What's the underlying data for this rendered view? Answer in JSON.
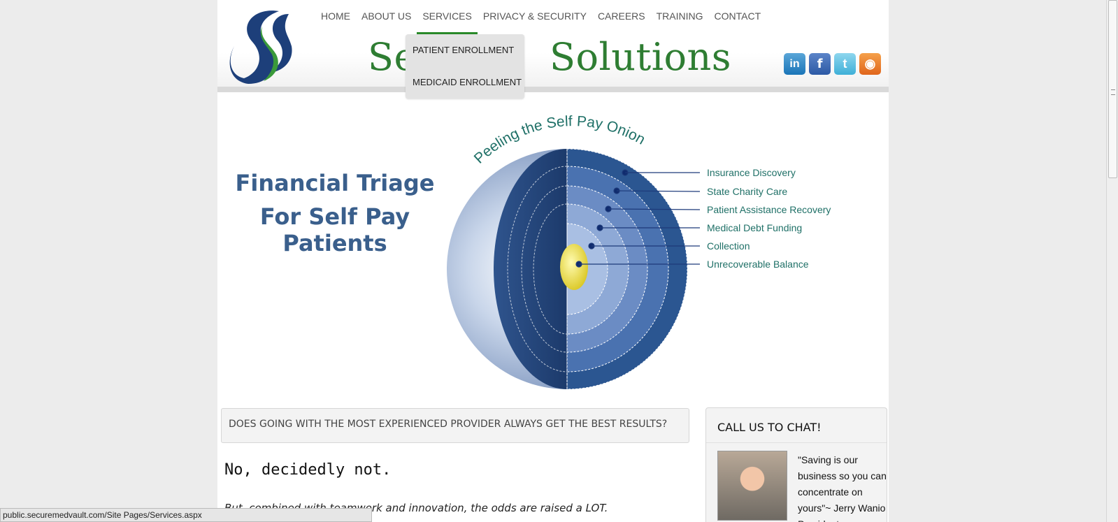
{
  "nav": {
    "items": [
      {
        "label": "HOME"
      },
      {
        "label": "ABOUT US"
      },
      {
        "label": "SERVICES"
      },
      {
        "label": "PRIVACY & SECURITY"
      },
      {
        "label": "CAREERS"
      },
      {
        "label": "TRAINING"
      },
      {
        "label": "CONTACT"
      }
    ],
    "active": "SERVICES"
  },
  "brand": {
    "visible_text_left": "Se",
    "visible_text_right": "Solutions",
    "color": "#2e7d32"
  },
  "dropdown": {
    "items": [
      {
        "label": "PATIENT ENROLLMENT"
      },
      {
        "label": "MEDICAID ENROLLMENT"
      }
    ]
  },
  "social": {
    "icons": [
      {
        "name": "linkedin-icon",
        "glyph": "in"
      },
      {
        "name": "facebook-icon",
        "glyph": "f"
      },
      {
        "name": "twitter-icon",
        "glyph": "t"
      },
      {
        "name": "rss-icon",
        "glyph": "◉"
      }
    ]
  },
  "hero": {
    "title_line1": "Financial Triage",
    "title_line2": "For Self Pay Patients",
    "onion_title": "Peeling the Self Pay Onion",
    "layers": [
      "Insurance Discovery",
      "State Charity Care",
      "Patient Assistance Recovery",
      "Medical Debt Funding",
      "Collection",
      "Unrecoverable Balance"
    ]
  },
  "main": {
    "question": "DOES GOING WITH THE MOST EXPERIENCED PROVIDER ALWAYS GET THE BEST RESULTS?",
    "answer": "No, decidedly not.",
    "subtext": "But, combined with teamwork and innovation, the odds are raised a LOT."
  },
  "sidebar": {
    "chat_title": "CALL US TO CHAT!",
    "quote": "\"Saving is our business so you can concentrate on yours\"~ Jerry Wanio President"
  },
  "status": {
    "url": "public.securemedvault.com/Site Pages/Services.aspx"
  },
  "colors": {
    "accent_green": "#2a8a2a",
    "hero_blue": "#3a5f8c",
    "teal_label": "#1f7067"
  }
}
